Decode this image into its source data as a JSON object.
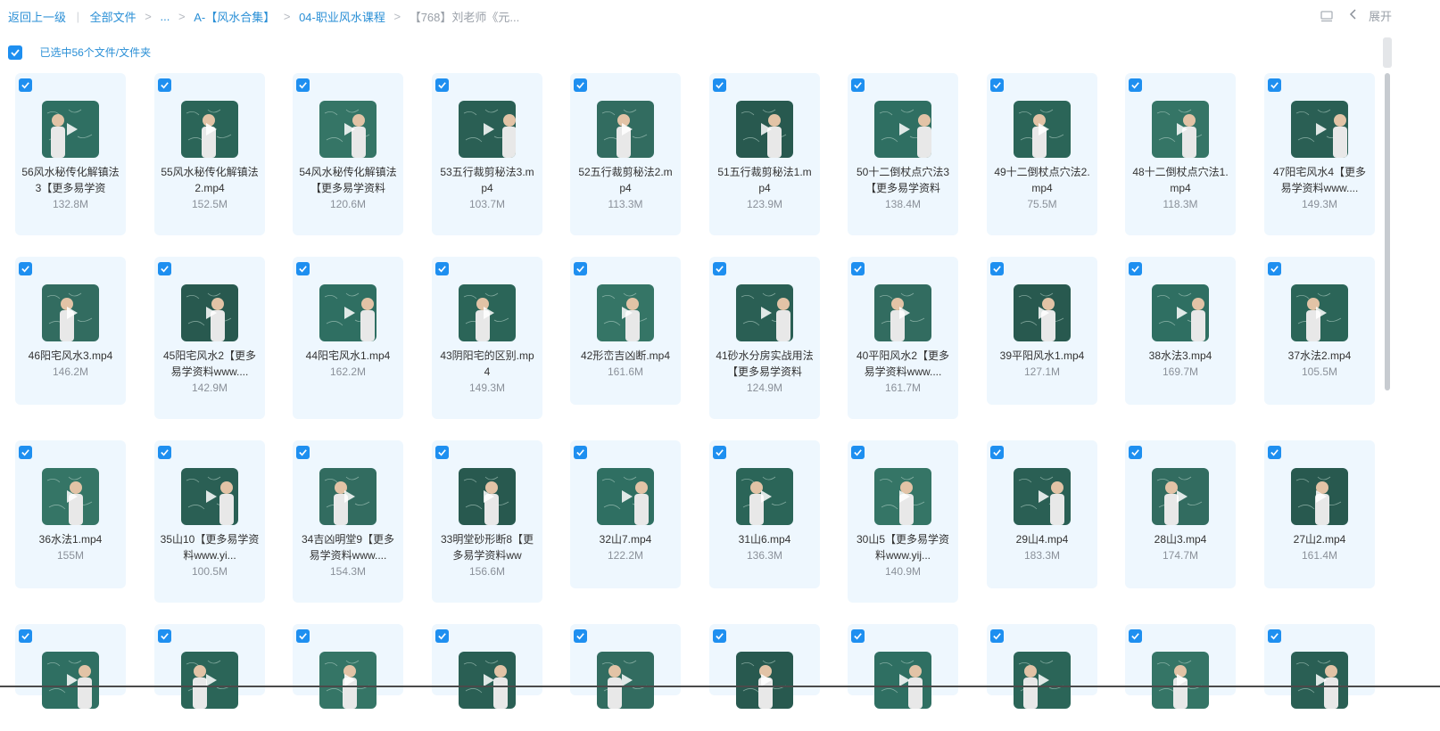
{
  "breadcrumb": {
    "back": "返回上一级",
    "all_files": "全部文件",
    "ellipsis": "...",
    "level1": "A-【风水合集】",
    "level2": "04-职业风水课程",
    "current": "【768】刘老师《元..."
  },
  "topright": {
    "expand_label": "展开"
  },
  "selection": {
    "label": "已选中56个文件/文件夹"
  },
  "files": [
    {
      "name": "56风水秘传化解镇法3【更多易学资",
      "size": "132.8M"
    },
    {
      "name": "55风水秘传化解镇法2.mp4",
      "size": "152.5M"
    },
    {
      "name": "54风水秘传化解镇法【更多易学资料",
      "size": "120.6M"
    },
    {
      "name": "53五行裁剪秘法3.mp4",
      "size": "103.7M"
    },
    {
      "name": "52五行裁剪秘法2.mp4",
      "size": "113.3M"
    },
    {
      "name": "51五行裁剪秘法1.mp4",
      "size": "123.9M"
    },
    {
      "name": "50十二倒杖点穴法3【更多易学资料",
      "size": "138.4M"
    },
    {
      "name": "49十二倒杖点穴法2.mp4",
      "size": "75.5M"
    },
    {
      "name": "48十二倒杖点穴法1.mp4",
      "size": "118.3M"
    },
    {
      "name": "47阳宅风水4【更多易学资料www....",
      "size": "149.3M"
    },
    {
      "name": "46阳宅风水3.mp4",
      "size": "146.2M"
    },
    {
      "name": "45阳宅风水2【更多易学资料www....",
      "size": "142.9M"
    },
    {
      "name": "44阳宅风水1.mp4",
      "size": "162.2M"
    },
    {
      "name": "43阴阳宅的区别.mp4",
      "size": "149.3M"
    },
    {
      "name": "42形峦吉凶断.mp4",
      "size": "161.6M"
    },
    {
      "name": "41砂水分房实战用法【更多易学资料",
      "size": "124.9M"
    },
    {
      "name": "40平阳风水2【更多易学资料www....",
      "size": "161.7M"
    },
    {
      "name": "39平阳风水1.mp4",
      "size": "127.1M"
    },
    {
      "name": "38水法3.mp4",
      "size": "169.7M"
    },
    {
      "name": "37水法2.mp4",
      "size": "105.5M"
    },
    {
      "name": "36水法1.mp4",
      "size": "155M"
    },
    {
      "name": "35山10【更多易学资料www.yi...",
      "size": "100.5M"
    },
    {
      "name": "34吉凶明堂9【更多易学资料www....",
      "size": "154.3M"
    },
    {
      "name": "33明堂砂形断8【更多易学资料ww",
      "size": "156.6M"
    },
    {
      "name": "32山7.mp4",
      "size": "122.2M"
    },
    {
      "name": "31山6.mp4",
      "size": "136.3M"
    },
    {
      "name": "30山5【更多易学资料www.yij...",
      "size": "140.9M"
    },
    {
      "name": "29山4.mp4",
      "size": "183.3M"
    },
    {
      "name": "28山3.mp4",
      "size": "174.7M"
    },
    {
      "name": "27山2.mp4",
      "size": "161.4M"
    },
    {
      "name": "",
      "size": ""
    },
    {
      "name": "",
      "size": ""
    },
    {
      "name": "",
      "size": ""
    },
    {
      "name": "",
      "size": ""
    },
    {
      "name": "",
      "size": ""
    },
    {
      "name": "",
      "size": ""
    },
    {
      "name": "",
      "size": ""
    },
    {
      "name": "",
      "size": ""
    },
    {
      "name": "",
      "size": ""
    },
    {
      "name": "",
      "size": ""
    }
  ],
  "colors": {
    "accent": "#1e8ff0",
    "card_bg": "#eef7fe",
    "board": "#2f6f62"
  }
}
